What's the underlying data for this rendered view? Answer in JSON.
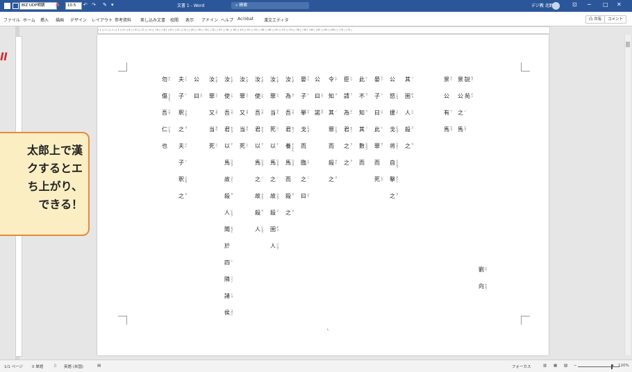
{
  "titlebar": {
    "font_name": "BIZ UDP明朝",
    "font_size": "10.5",
    "doc_title": "文書 1 - Word",
    "search_placeholder": "検索",
    "user_name": "デジ教 北野",
    "min": "─",
    "max": "□",
    "close": "✕",
    "ribbon_display": "⊡"
  },
  "ribbon": {
    "tabs": [
      "ファイル",
      "ホーム",
      "挿入",
      "描画",
      "デザイン",
      "レイアウト",
      "参考資料",
      "差し込み文書",
      "校閲",
      "表示",
      "アドイン",
      "ヘルプ",
      "Acrobat",
      "漢文エディタ"
    ],
    "share": "凸 共有",
    "comment": "コメント"
  },
  "ruler": "| 4 | | 2 | |  | 2 | | 4 | | 6 | | 8 | | 10 | | 12 | | 14 | | 16 | | 18 | | 20 | | 22 | | 24 | | 26 | | 28 | | 30 | | 32 | | 34 | | 36 | | 38 | | 40 | | 42 | | 44 | | 46 | | 48 | | 50 | | 52 | | 54 | | 56 | | 58 | | 60 | | 62 | | 64 | | 66 | |  | 70 | | 74 |",
  "callout": {
    "lines": [
      "太郎上で漢",
      "クするとエ",
      "ち上がり、",
      "できる！"
    ]
  },
  "red_label": "ll",
  "document": {
    "columns": [
      {
        "chars": [
          {
            "t": "劉",
            "f": "リウ"
          },
          {
            "t": "向",
            "f": "キャウ"
          }
        ],
        "note": "author"
      },
      {
        "chars": [
          {
            "t": "說",
            "f": "セイ"
          },
          {
            "t": "苑",
            "f": "エン"
          }
        ]
      },
      {
        "chars": [
          {
            "t": "景",
            "f": "ケイ"
          },
          {
            "t": "公",
            "f": ""
          },
          {
            "t": "之",
            "f": "ノ"
          },
          {
            "t": "馬",
            "f": "ウマ"
          }
        ]
      },
      {
        "chars": [
          {
            "t": "景",
            "f": "ケイ"
          },
          {
            "t": "公",
            "f": ""
          },
          {
            "t": "有",
            "f": "リ"
          },
          {
            "t": "馬",
            "f": "ウマ"
          }
        ]
      },
      {
        "chars": [
          {
            "t": "其",
            "f": "ノ"
          },
          {
            "t": "圉",
            "f": "ギョ"
          },
          {
            "t": "人",
            "f": "ジン"
          },
          {
            "t": "殺",
            "f": "ス"
          },
          {
            "t": "之",
            "f": "ヲ"
          }
        ]
      },
      {
        "chars": [
          {
            "t": "公",
            "f": ""
          },
          {
            "t": "怒",
            "f": "イカリ"
          },
          {
            "t": "援",
            "f": "リテ"
          },
          {
            "t": "戈",
            "f": "ホコヲ"
          },
          {
            "t": "将",
            "f": "マサニ"
          },
          {
            "t": "自",
            "f": "ミヅカラ"
          },
          {
            "t": "擊",
            "f": "タント"
          },
          {
            "t": "之",
            "f": "ヲ"
          }
        ]
      },
      {
        "chars": [
          {
            "t": "晏",
            "f": "アン"
          },
          {
            "t": "子",
            "f": "シ"
          },
          {
            "t": "曰",
            "f": "ハク"
          },
          {
            "t": "此",
            "f": "レ"
          },
          {
            "t": "罪",
            "f": "ヲ"
          },
          {
            "t": "而",
            "f": ""
          },
          {
            "t": "死",
            "f": "シス"
          }
        ]
      },
      {
        "chars": [
          {
            "t": "此",
            "f": "レ"
          },
          {
            "t": "不",
            "f": "ズ"
          },
          {
            "t": "知",
            "f": "ラ"
          },
          {
            "t": "其",
            "f": "ノ"
          },
          {
            "t": "數",
            "f": "セメヨ"
          },
          {
            "t": "而",
            "f": ""
          }
        ]
      },
      {
        "chars": [
          {
            "t": "臣",
            "f": "シン"
          },
          {
            "t": "請",
            "f": "フ"
          },
          {
            "t": "為",
            "f": "メニ"
          },
          {
            "t": "君",
            "f": "キミノ"
          },
          {
            "t": "之",
            "f": "ヲ"
          },
          {
            "t": "之",
            "f": "ヲ"
          }
        ]
      },
      {
        "chars": [
          {
            "t": "令",
            "f": "シテ"
          },
          {
            "t": "知",
            "f": "ラ"
          },
          {
            "t": "其",
            "f": "ノ"
          },
          {
            "t": "罪",
            "f": "ツミヲ"
          },
          {
            "t": "而",
            "f": ""
          },
          {
            "t": "殺",
            "f": "サン"
          },
          {
            "t": "之",
            "f": "ヲ"
          }
        ]
      },
      {
        "chars": [
          {
            "t": "公",
            "f": ""
          },
          {
            "t": "曰",
            "f": "ハク"
          },
          {
            "t": "諾",
            "f": "ダク"
          }
        ]
      },
      {
        "chars": [
          {
            "t": "晏",
            "f": "アン"
          },
          {
            "t": "子",
            "f": "シ"
          },
          {
            "t": "擧",
            "f": "ゲテ"
          },
          {
            "t": "戈",
            "f": "ホコヲ"
          },
          {
            "t": "而",
            "f": ""
          },
          {
            "t": "臨",
            "f": "ミテ"
          },
          {
            "t": "之",
            "f": "ニ"
          },
          {
            "t": "曰",
            "f": "ハク"
          }
        ]
      },
      {
        "chars": [
          {
            "t": "汝",
            "f": "ナンヂ"
          },
          {
            "t": "為",
            "f": "メニ"
          },
          {
            "t": "吾",
            "f": "ワガ"
          },
          {
            "t": "君",
            "f": "キミノ"
          },
          {
            "t": "養",
            "f": "ヤシナヒ"
          },
          {
            "t": "馬",
            "f": "ウマヲ"
          },
          {
            "t": "而",
            "f": ""
          },
          {
            "t": "殺",
            "f": "ス"
          },
          {
            "t": "之",
            "f": "ヲ"
          }
        ]
      },
      {
        "chars": [
          {
            "t": "汝",
            "f": "ナンヂ"
          },
          {
            "t": "罪",
            "f": "ツミ"
          },
          {
            "t": "当",
            "f": "タル"
          },
          {
            "t": "死",
            "f": "シニ"
          },
          {
            "t": "以",
            "f": "テ"
          },
          {
            "t": "馬",
            "f": "ウマヲ"
          },
          {
            "t": "之",
            "f": "ノ"
          },
          {
            "t": "故",
            "f": "ユエヲ"
          },
          {
            "t": "殺",
            "f": "ス"
          },
          {
            "t": "圉",
            "f": "ギョ"
          },
          {
            "t": "人",
            "f": "ジンヲ"
          }
        ]
      },
      {
        "chars": [
          {
            "t": "汝",
            "f": "ナンヂ"
          },
          {
            "t": "使",
            "f": "シム"
          },
          {
            "t": "吾",
            "f": "ワガ"
          },
          {
            "t": "君",
            "f": "キミヲ"
          },
          {
            "t": "以",
            "f": "テ"
          },
          {
            "t": "馬",
            "f": "ウマヲ"
          },
          {
            "t": "之",
            "f": "ノ"
          },
          {
            "t": "故",
            "f": "ユエヲ"
          },
          {
            "t": "殺",
            "f": "サ"
          },
          {
            "t": "人",
            "f": "ヒトヲ"
          }
        ]
      },
      {
        "chars": [
          {
            "t": "汝",
            "f": "ナンヂ"
          },
          {
            "t": "罪",
            "f": "ツミ"
          },
          {
            "t": "又",
            "f": "マタ"
          },
          {
            "t": "当",
            "f": "タル"
          },
          {
            "t": "死",
            "f": "シニ"
          }
        ]
      },
      {
        "chars": [
          {
            "t": "汝",
            "f": "ナンヂ"
          },
          {
            "t": "使",
            "f": "シム"
          },
          {
            "t": "吾",
            "f": "ワガ"
          },
          {
            "t": "君",
            "f": "キミヲ"
          },
          {
            "t": "以",
            "f": "テ"
          },
          {
            "t": "馬",
            "f": "ウマヲ"
          },
          {
            "t": "故",
            "f": "ユエニ"
          },
          {
            "t": "殺",
            "f": "サ"
          },
          {
            "t": "人",
            "f": "ヒトヲ"
          },
          {
            "t": "聞",
            "f": "キコエ"
          },
          {
            "t": "於",
            "f": ""
          },
          {
            "t": "四",
            "f": "シ"
          },
          {
            "t": "隣",
            "f": "リンノ"
          },
          {
            "t": "諸",
            "f": "ショ"
          },
          {
            "t": "侯",
            "f": "コウニ"
          }
        ]
      },
      {
        "chars": [
          {
            "t": "汝",
            "f": "ナンヂ"
          },
          {
            "t": "罪",
            "f": "ツミ"
          },
          {
            "t": "又",
            "f": "マタ"
          },
          {
            "t": "当",
            "f": "タル"
          },
          {
            "t": "死",
            "f": "シニ"
          }
        ]
      },
      {
        "chars": [
          {
            "t": "公",
            "f": ""
          },
          {
            "t": "曰",
            "f": "ハク"
          }
        ]
      },
      {
        "chars": [
          {
            "t": "夫",
            "f": "ソレ"
          },
          {
            "t": "子",
            "f": "シ"
          },
          {
            "t": "釈",
            "f": "ユルセ"
          },
          {
            "t": "之",
            "f": "ヲ"
          },
          {
            "t": "夫",
            "f": "ソレ"
          },
          {
            "t": "子",
            "f": "シ"
          },
          {
            "t": "釈",
            "f": "ユルセ"
          },
          {
            "t": "之",
            "f": "ヲ"
          }
        ]
      },
      {
        "chars": [
          {
            "t": "勿",
            "f": "カレ"
          },
          {
            "t": "傷",
            "f": "ソコナフ"
          },
          {
            "t": "吾",
            "f": "ワガ"
          },
          {
            "t": "仁",
            "f": "ジンヲ"
          },
          {
            "t": "也",
            "f": ""
          }
        ]
      }
    ],
    "cursor_char": "ㄴ"
  },
  "statusbar": {
    "page": "1/1 ページ",
    "words": "0 単語",
    "lang": "英語 (米国)",
    "focus": "フォーカス",
    "zoom": "120%",
    "zoom_level": 0.8
  }
}
